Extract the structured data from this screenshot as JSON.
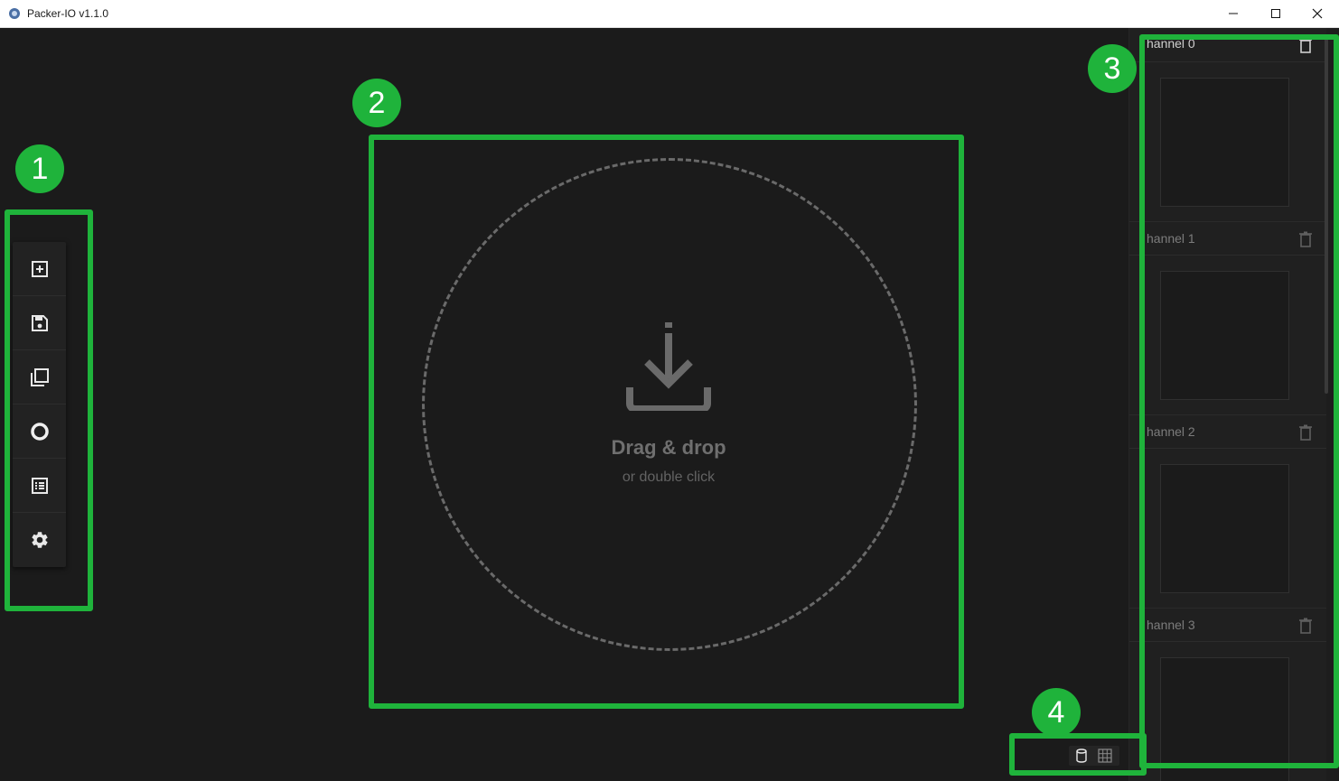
{
  "window": {
    "title": "Packer-IO v1.1.0",
    "controls": [
      "minimize",
      "maximize",
      "close"
    ]
  },
  "toolbar": {
    "items": [
      {
        "name": "new",
        "icon": "add-box-icon"
      },
      {
        "name": "save",
        "icon": "save-icon"
      },
      {
        "name": "copy",
        "icon": "copy-icon"
      },
      {
        "name": "circle",
        "icon": "circle-icon"
      },
      {
        "name": "list",
        "icon": "list-icon"
      },
      {
        "name": "settings",
        "icon": "gear-icon"
      }
    ]
  },
  "dropzone": {
    "title": "Drag & drop",
    "subtitle": "or double click",
    "icon": "download-icon"
  },
  "channels": [
    {
      "label": "hannel 0"
    },
    {
      "label": "hannel 1"
    },
    {
      "label": "hannel 2"
    },
    {
      "label": "hannel 3"
    }
  ],
  "status": {
    "icons": [
      "database-icon",
      "grid-icon"
    ]
  },
  "annotations": [
    "1",
    "2",
    "3",
    "4"
  ],
  "colors": {
    "annotation": "#1fb33b",
    "background": "#1b1b1b",
    "panel": "#202020"
  }
}
